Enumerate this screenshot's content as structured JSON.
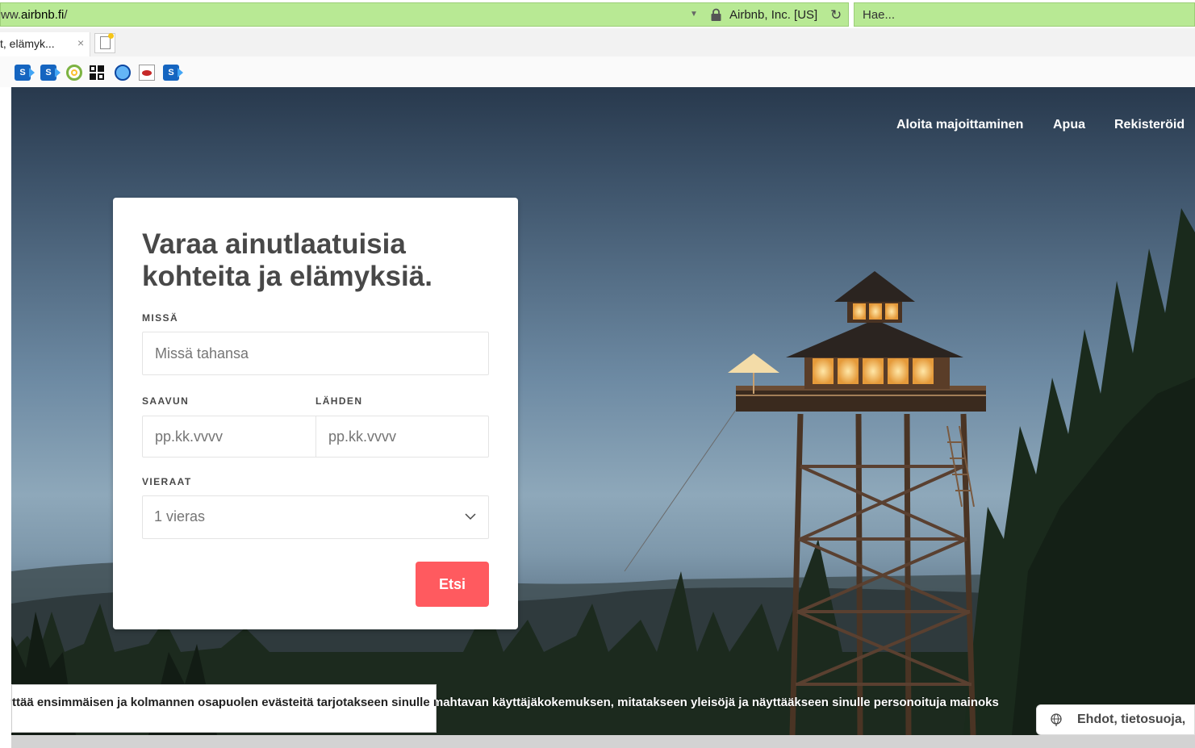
{
  "browser": {
    "url_prefix": "ww.",
    "url_domain": "airbnb.fi",
    "url_suffix": "/",
    "site_identity": "Airbnb, Inc. [US]",
    "search_placeholder": "Hae...",
    "tab_title": "t, elämyk...",
    "tab_close": "×",
    "favorites": [
      "sharepoint-icon",
      "sharepoint-icon",
      "target-icon",
      "grid-logo-icon",
      "ie-icon",
      "red-logo-icon",
      "sharepoint-icon"
    ],
    "favorite_sp_letter": "S"
  },
  "nav": {
    "host_label": "Aloita majoittaminen",
    "help_label": "Apua",
    "signup_label": "Rekisteröid"
  },
  "search_card": {
    "headline": "Varaa ainutlaatuisia kohteita ja elämyksiä.",
    "where_label": "MISSÄ",
    "where_placeholder": "Missä tahansa",
    "checkin_label": "SAAVUN",
    "checkin_placeholder": "pp.kk.vvvv",
    "checkout_label": "LÄHDEN",
    "checkout_placeholder": "pp.kk.vvvv",
    "guests_label": "VIERAAT",
    "guests_value": "1 vieras",
    "search_button": "Etsi"
  },
  "cookie": {
    "text": "ttää ensimmäisen ja kolmannen osapuolen evästeitä tarjotakseen sinulle mahtavan käyttäjäkokemuksen, mitatakseen yleisöjä ja näyttääkseen sinulle personoituja mainoks"
  },
  "footer": {
    "terms_label": "Ehdot, tietosuoja,"
  },
  "colors": {
    "brand": "#ff5a5f",
    "address_bar": "#b8e994",
    "text": "#484848"
  }
}
